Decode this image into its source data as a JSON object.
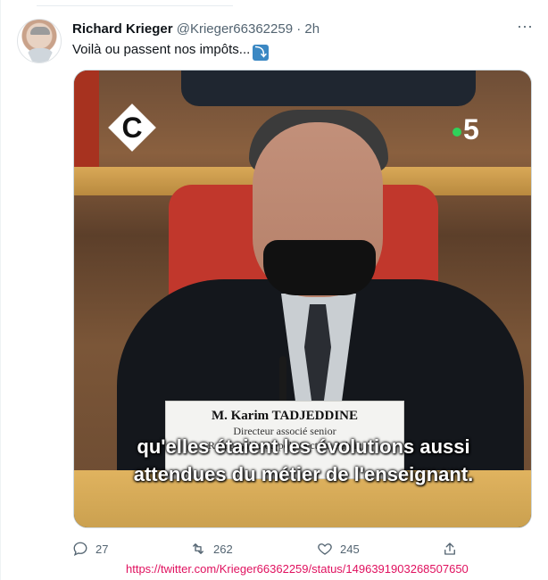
{
  "tweet": {
    "author_name": "Richard Krieger",
    "handle": "@Krieger66362259",
    "separator": "·",
    "time": "2h",
    "text": "Voilà ou passent nos impôts...",
    "text_emoji": "⤵",
    "more_icon": "more-icon"
  },
  "media": {
    "channel_logo_left": "C",
    "channel_logo_right": "5",
    "nameplate": {
      "name": "M. Karim TADJEDDINE",
      "line1": "Directeur associé senior",
      "line2": "Responsable du pôle Secteur Public"
    },
    "subtitle_line1": "qu'elles étaient les évolutions aussi",
    "subtitle_line2": "attendues du métier de l'enseignant."
  },
  "actions": {
    "reply_count": "27",
    "retweet_count": "262",
    "like_count": "245",
    "share_icon": "share-icon"
  },
  "source_url": "https://twitter.com/Krieger66362259/status/1496391903268507650"
}
